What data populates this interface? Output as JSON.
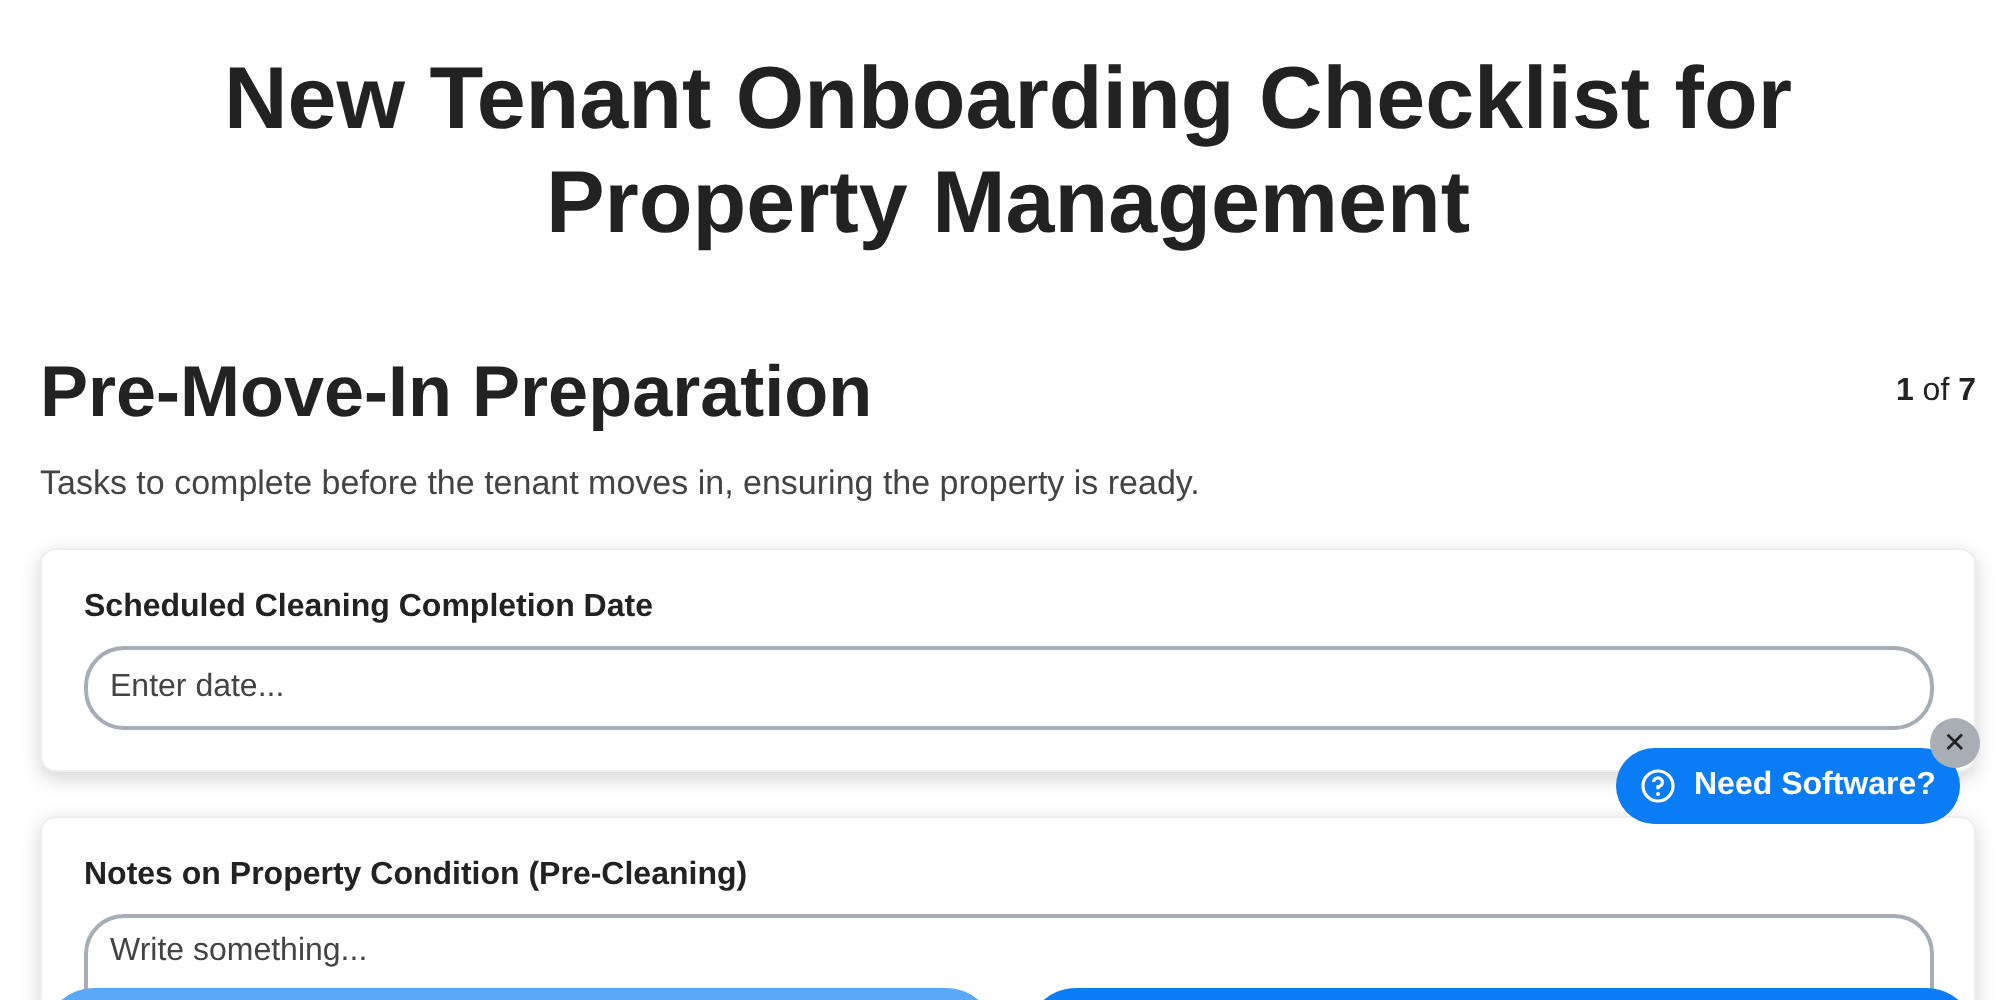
{
  "title": "New Tenant Onboarding Checklist for Property Management",
  "section": {
    "heading": "Pre-Move-In Preparation",
    "counter": "**1** of **7**",
    "description": "Tasks to complete before the tenant moves in, ensuring the property is ready."
  },
  "fields": [
    {
      "kind": "input",
      "label": "Scheduled Cleaning Completion Date",
      "placeholder": "Enter date..."
    },
    {
      "kind": "textarea",
      "label": "Notes on Property Condition (Pre-Cleaning)",
      "placeholder": "Write something..."
    }
  ],
  "nav_buttons": [
    {
      "kind": "secondary"
    },
    {
      "kind": "primary"
    }
  ],
  "help_widget": {
    "label": "Need Software?",
    "close": "✕"
  }
}
